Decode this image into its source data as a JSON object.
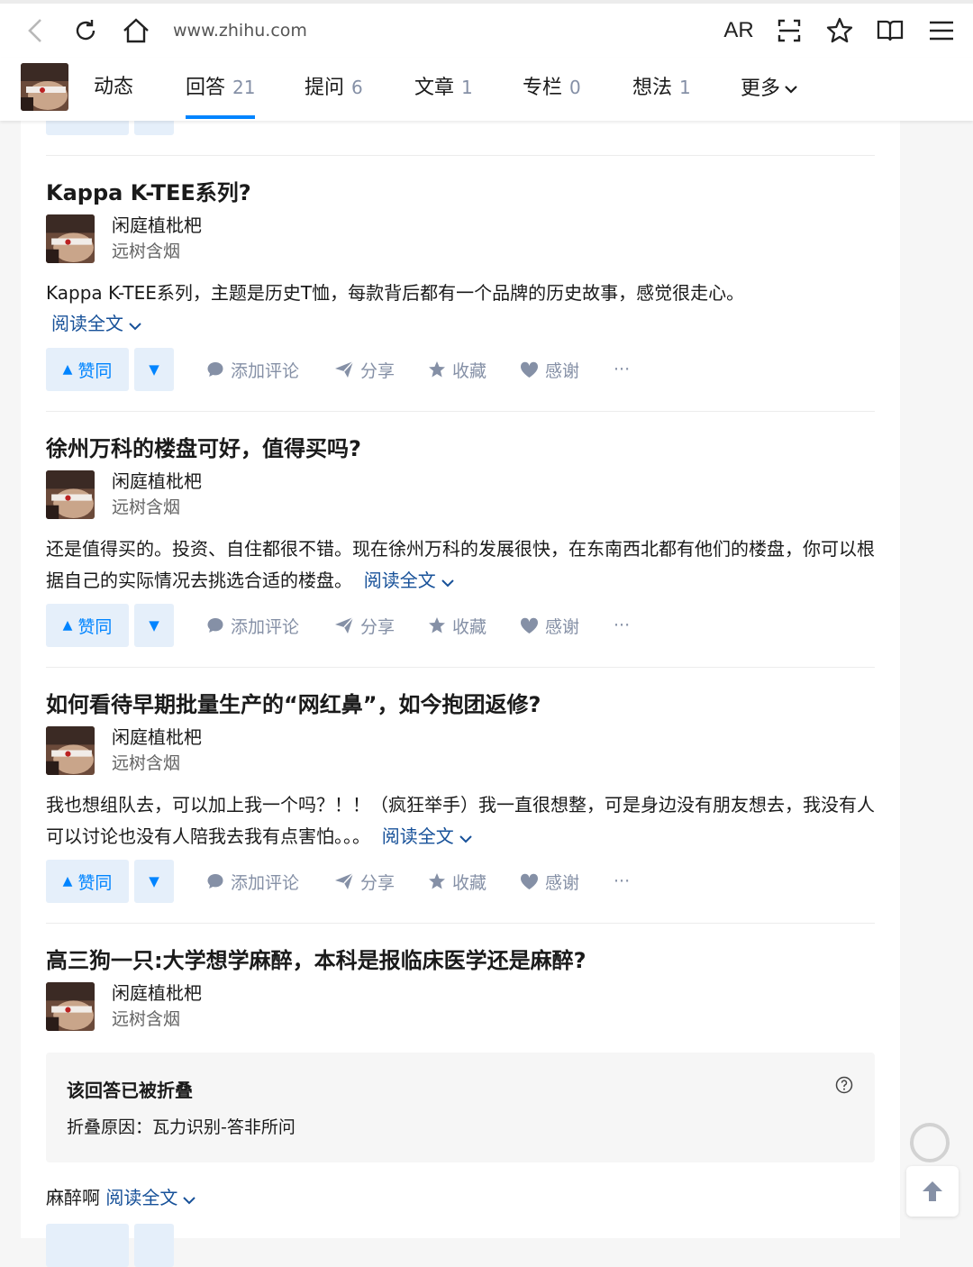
{
  "browser": {
    "url": "www.zhihu.com",
    "reader_label": "AR",
    "icons": [
      "back-icon",
      "reload-icon",
      "home-icon",
      "scan-icon",
      "star-icon",
      "book-icon",
      "menu-icon"
    ]
  },
  "profile_tabs": {
    "tabs": [
      {
        "label": "动态",
        "count": ""
      },
      {
        "label": "回答",
        "count": "21"
      },
      {
        "label": "提问",
        "count": "6"
      },
      {
        "label": "文章",
        "count": "1"
      },
      {
        "label": "专栏",
        "count": "0"
      },
      {
        "label": "想法",
        "count": "1"
      }
    ],
    "more_label": "更多",
    "active_tab": "回答"
  },
  "actions_labels": {
    "upvote": "赞同",
    "comment": "添加评论",
    "share": "分享",
    "collect": "收藏",
    "thanks": "感谢",
    "more": "···"
  },
  "answers": [
    {
      "question": "Kappa K-TEE系列?",
      "author_name": "闲庭植枇杷",
      "author_signature": "远树含烟",
      "excerpt": "Kappa K-TEE系列，主题是历史T恤，每款背后都有一个品牌的历史故事，感觉很走心。",
      "read_more": "阅读全文"
    },
    {
      "question": "徐州万科的楼盘可好，值得买吗?",
      "author_name": "闲庭植枇杷",
      "author_signature": "远树含烟",
      "excerpt": "还是值得买的。投资、自住都很不错。现在徐州万科的发展很快，在东南西北都有他们的楼盘，你可以根据自己的实际情况去挑选合适的楼盘。",
      "read_more": "阅读全文"
    },
    {
      "question": "如何看待早期批量生产的“网红鼻”，如今抱团返修?",
      "author_name": "闲庭植枇杷",
      "author_signature": "远树含烟",
      "excerpt": "我也想组队去，可以加上我一个吗？！！（疯狂举手）我一直很想整，可是身边没有朋友想去，我没有人可以讨论也没有人陪我去我有点害怕。。。",
      "read_more": "阅读全文"
    },
    {
      "question": "高三狗一只:大学想学麻醉，本科是报临床医学还是麻醉?",
      "author_name": "闲庭植枇杷",
      "author_signature": "远树含烟",
      "collapsed_title": "该回答已被折叠",
      "collapsed_reason": "折叠原因：瓦力识别-答非所问",
      "excerpt": "麻醉啊",
      "read_more": "阅读全文"
    }
  ],
  "colors": {
    "brand_blue": "#0084ff",
    "link_blue": "#175199",
    "muted": "#8590a6",
    "vote_bg": "#e5effa"
  }
}
